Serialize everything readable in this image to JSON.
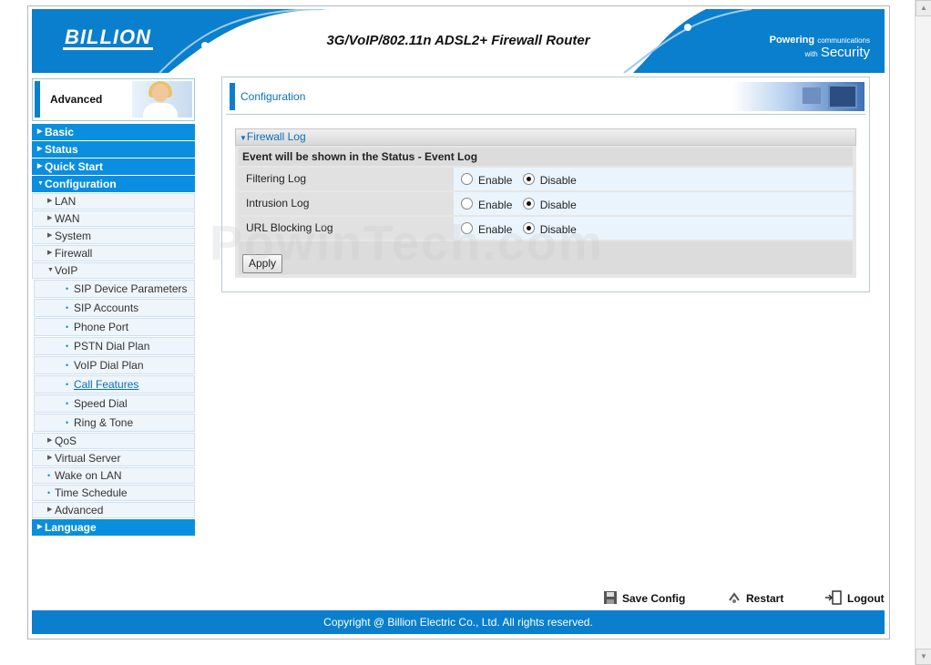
{
  "header": {
    "logo": "BILLION",
    "product_title": "3G/VoIP/802.11n ADSL2+ Firewall Router",
    "tagline_word1": "Powering",
    "tagline_word2": "communications",
    "tagline_word3": "with",
    "tagline_word4": "Security"
  },
  "advanced_badge": "Advanced",
  "menu": {
    "basic": "Basic",
    "status": "Status",
    "quick_start": "Quick Start",
    "configuration": "Configuration",
    "lan": "LAN",
    "wan": "WAN",
    "system": "System",
    "firewall": "Firewall",
    "voip": "VoIP",
    "sip_device_parameters": "SIP Device Parameters",
    "sip_accounts": "SIP Accounts",
    "phone_port": "Phone Port",
    "pstn_dial_plan": "PSTN Dial Plan",
    "voip_dial_plan": "VoIP Dial Plan",
    "call_features": "Call Features",
    "speed_dial": "Speed Dial",
    "ring_tone": "Ring & Tone",
    "qos": "QoS",
    "virtual_server": "Virtual Server",
    "wake_on_lan": "Wake on LAN",
    "time_schedule": "Time Schedule",
    "advanced": "Advanced",
    "language": "Language"
  },
  "content": {
    "title": "Configuration",
    "section_title": "Firewall Log",
    "notice": "Event will be shown in the Status - Event Log",
    "rows": [
      {
        "label": "Filtering Log",
        "enable": "Enable",
        "disable": "Disable",
        "selected": "Disable"
      },
      {
        "label": "Intrusion Log",
        "enable": "Enable",
        "disable": "Disable",
        "selected": "Disable"
      },
      {
        "label": "URL Blocking Log",
        "enable": "Enable",
        "disable": "Disable",
        "selected": "Disable"
      }
    ],
    "apply_label": "Apply"
  },
  "watermark": "PowinTech.com",
  "actions": {
    "save_config": "Save Config",
    "restart": "Restart",
    "logout": "Logout"
  },
  "footer": "Copyright @ Billion Electric Co., Ltd. All rights reserved.",
  "colors": {
    "brand_blue": "#0a7fcd",
    "menu_blue": "#0a8ee0"
  }
}
